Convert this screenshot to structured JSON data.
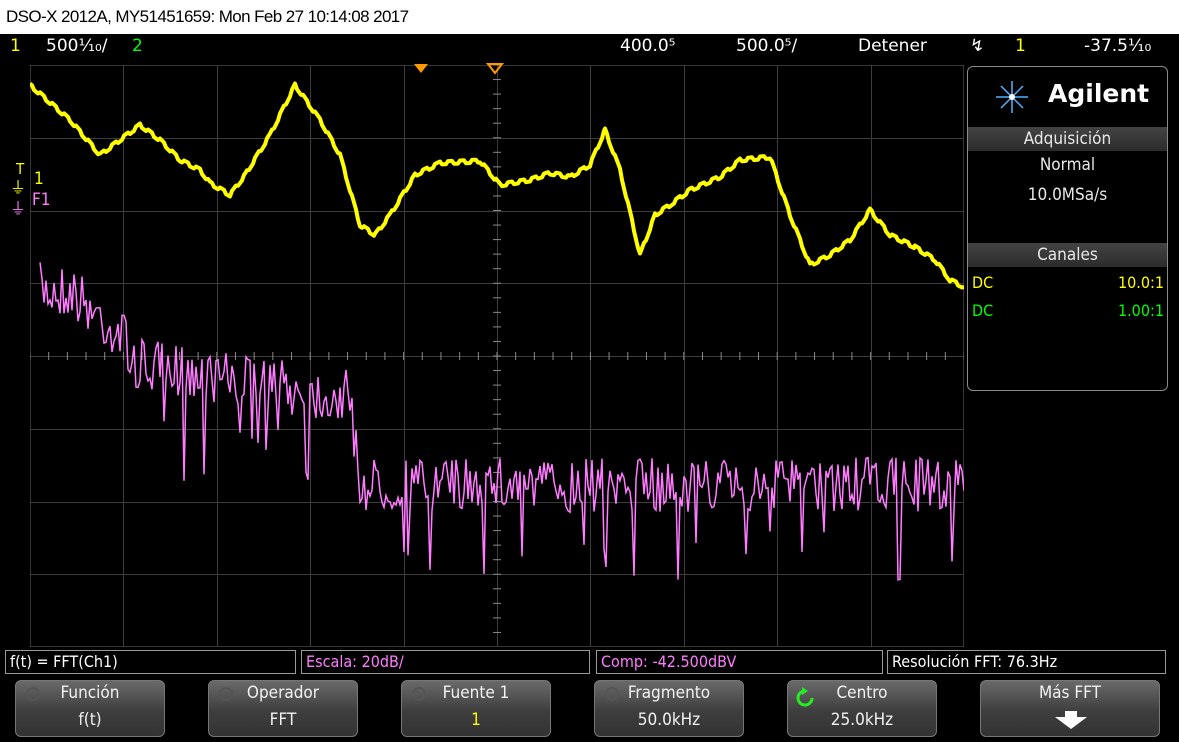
{
  "caption": "DSO-X 2012A, MY51451659: Mon Feb 27 10:14:08 2017",
  "status": {
    "ch1_num": "1",
    "ch1_scale": "500⅒/",
    "ch2_num": "2",
    "time_delay": "400.0⁵",
    "time_scale": "500.0⁵/",
    "run_state": "Detener",
    "trigger_source": "1",
    "trigger_level": "-37.5⅒"
  },
  "markers": {
    "ch1": "1",
    "fft": "F1",
    "trigger": "T"
  },
  "panel": {
    "brand": "Agilent",
    "acq_title": "Adquisición",
    "acq_mode": "Normal",
    "acq_rate": "10.0MSa/s",
    "ch_title": "Canales",
    "channels": [
      {
        "coupling": "DC",
        "probe": "10.0:1",
        "color": "#ffff00"
      },
      {
        "coupling": "DC",
        "probe": "1.00:1",
        "color": "#00ff00"
      }
    ]
  },
  "infobar": {
    "func": "f(t) = FFT(Ch1)",
    "scale": "Escala: 20dB/",
    "offset": "Comp: -42.500dBV",
    "resolution": "Resolución FFT: 76.3Hz"
  },
  "softkeys": [
    {
      "title": "Función",
      "value": "f(t)"
    },
    {
      "title": "Operador",
      "value": "FFT"
    },
    {
      "title": "Fuente 1",
      "value": "1"
    },
    {
      "title": "Fragmento",
      "value": "50.0kHz"
    },
    {
      "title": "Centro",
      "value": "25.0kHz"
    },
    {
      "title": "Más FFT",
      "value": ""
    }
  ],
  "colors": {
    "ch1": "#ffff00",
    "ch2": "#00ff00",
    "math": "#ff7cff",
    "trigger_marker": "#ff9a00"
  }
}
